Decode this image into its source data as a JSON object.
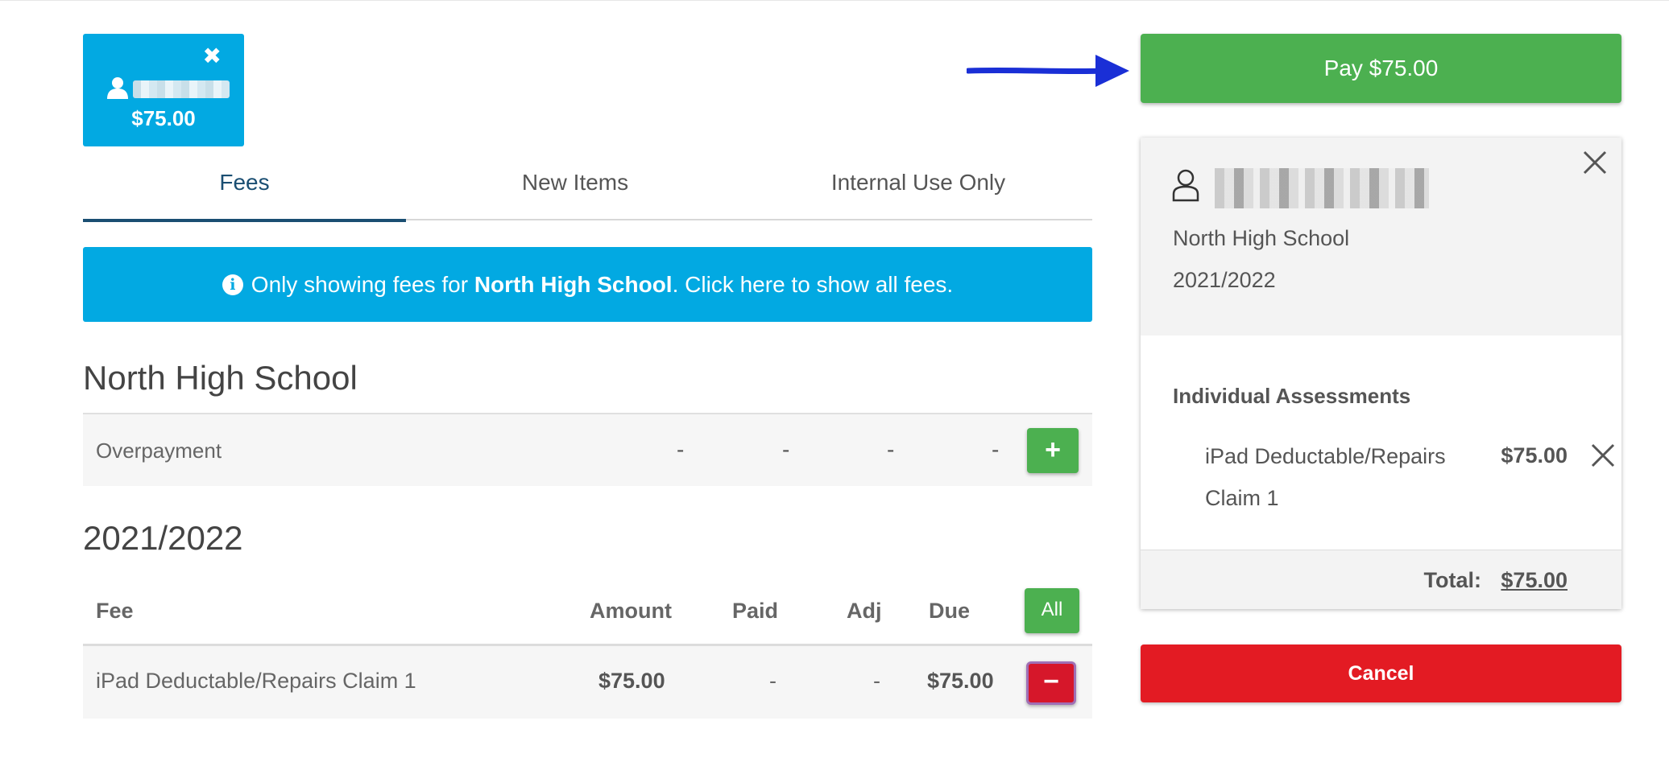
{
  "student_tile": {
    "amount": "$75.00",
    "icons": [
      "close-icon",
      "person-icon"
    ]
  },
  "tabs": [
    {
      "label": "Fees",
      "active": true
    },
    {
      "label": "New Items",
      "active": false
    },
    {
      "label": "Internal Use Only",
      "active": false
    }
  ],
  "banner": {
    "prefix": "Only showing fees for ",
    "school": "North High School",
    "suffix": ". Click here to show all fees."
  },
  "school_section": {
    "title": "North High School",
    "overpayment": {
      "label": "Overpayment",
      "values": [
        "-",
        "-",
        "-",
        "-"
      ],
      "add_label": "+"
    }
  },
  "year_section": {
    "title": "2021/2022",
    "headers": {
      "fee": "Fee",
      "amount": "Amount",
      "paid": "Paid",
      "adj": "Adj",
      "due": "Due",
      "all_button": "All"
    },
    "rows": [
      {
        "fee": "iPad Deductable/Repairs Claim 1",
        "amount": "$75.00",
        "paid": "-",
        "adj": "-",
        "due": "$75.00",
        "remove_label": "−"
      }
    ]
  },
  "pay_button": {
    "label": "Pay $75.00"
  },
  "cart": {
    "school": "North High School",
    "year": "2021/2022",
    "section_title": "Individual Assessments",
    "item": {
      "name": "iPad Deductable/Repairs Claim 1",
      "amount": "$75.00"
    },
    "total_label": "Total:",
    "total_value": "$75.00"
  },
  "cancel_button": {
    "label": "Cancel"
  },
  "colors": {
    "accent_blue": "#02a9e2",
    "green": "#4cb050",
    "red": "#e31b23",
    "tab_active": "#1a4e72",
    "arrow": "#1a2fd6"
  }
}
